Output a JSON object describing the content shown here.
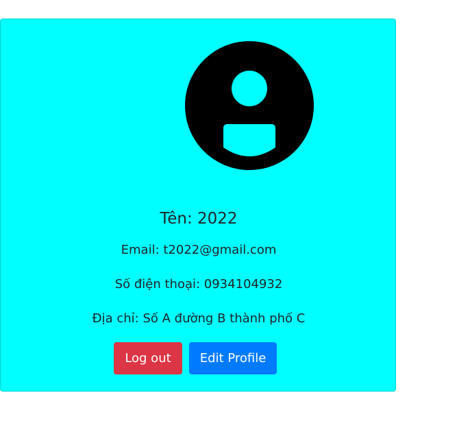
{
  "profile": {
    "name": "Tên: 2022",
    "email": "Email: t2022@gmail.com",
    "phone": "Số điện thoại: 0934104932",
    "address": "Địa chỉ: Số A đường B thành phố C"
  },
  "buttons": {
    "logout_label": "Log out",
    "edit_label": "Edit Profile"
  },
  "colors": {
    "card_background": "#00ffff",
    "logout": "#dc3545",
    "edit": "#007bff",
    "avatar": "#000000"
  },
  "icons": {
    "avatar": "account-circle-icon"
  }
}
